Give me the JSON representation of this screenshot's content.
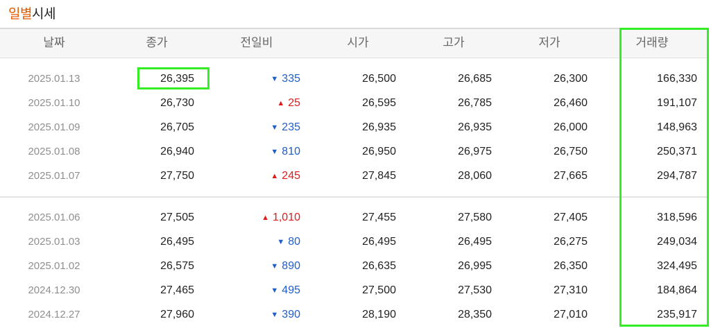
{
  "title": {
    "accent": "일별",
    "rest": "시세"
  },
  "columns": [
    "날짜",
    "종가",
    "전일비",
    "시가",
    "고가",
    "저가",
    "거래량"
  ],
  "rows": [
    {
      "date": "2025.01.13",
      "close": "26,395",
      "dir": "down",
      "arrow": "▼",
      "change": "335",
      "open": "26,500",
      "high": "26,685",
      "low": "26,300",
      "volume": "166,330"
    },
    {
      "date": "2025.01.10",
      "close": "26,730",
      "dir": "up",
      "arrow": "▲",
      "change": "25",
      "open": "26,595",
      "high": "26,785",
      "low": "26,460",
      "volume": "191,107"
    },
    {
      "date": "2025.01.09",
      "close": "26,705",
      "dir": "down",
      "arrow": "▼",
      "change": "235",
      "open": "26,935",
      "high": "26,935",
      "low": "26,000",
      "volume": "148,963"
    },
    {
      "date": "2025.01.08",
      "close": "26,940",
      "dir": "down",
      "arrow": "▼",
      "change": "810",
      "open": "26,950",
      "high": "26,975",
      "low": "26,750",
      "volume": "250,371"
    },
    {
      "date": "2025.01.07",
      "close": "27,750",
      "dir": "up",
      "arrow": "▲",
      "change": "245",
      "open": "27,845",
      "high": "28,060",
      "low": "27,665",
      "volume": "294,787"
    },
    {
      "date": "2025.01.06",
      "close": "27,505",
      "dir": "up",
      "arrow": "▲",
      "change": "1,010",
      "open": "27,455",
      "high": "27,580",
      "low": "27,405",
      "volume": "318,596"
    },
    {
      "date": "2025.01.03",
      "close": "26,495",
      "dir": "down",
      "arrow": "▼",
      "change": "80",
      "open": "26,495",
      "high": "26,495",
      "low": "26,275",
      "volume": "249,034"
    },
    {
      "date": "2025.01.02",
      "close": "26,575",
      "dir": "down",
      "arrow": "▼",
      "change": "890",
      "open": "26,635",
      "high": "26,995",
      "low": "26,350",
      "volume": "324,495"
    },
    {
      "date": "2024.12.30",
      "close": "27,465",
      "dir": "down",
      "arrow": "▼",
      "change": "495",
      "open": "27,500",
      "high": "27,530",
      "low": "27,310",
      "volume": "184,864"
    },
    {
      "date": "2024.12.27",
      "close": "27,960",
      "dir": "down",
      "arrow": "▼",
      "change": "390",
      "open": "28,190",
      "high": "28,350",
      "low": "27,010",
      "volume": "235,917"
    }
  ],
  "colors": {
    "accent": "#e05a00",
    "up": "#e01b1b",
    "down": "#1f5dc9",
    "highlight": "#33ee22"
  }
}
